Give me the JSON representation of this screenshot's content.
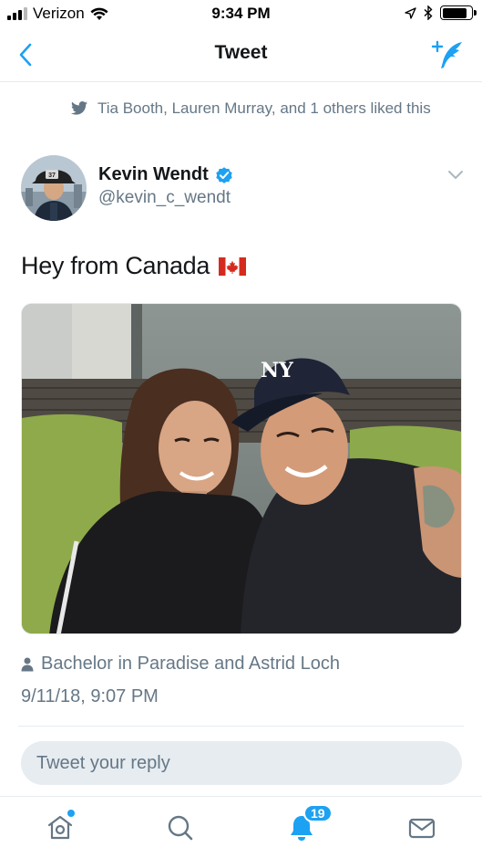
{
  "status_bar": {
    "carrier": "Verizon",
    "time": "9:34 PM",
    "battery_level": 0.85
  },
  "nav": {
    "title": "Tweet"
  },
  "social_context": {
    "text": "Tia Booth, Lauren Murray, and 1 others liked this"
  },
  "tweet": {
    "author_name": "Kevin Wendt",
    "author_handle": "@kevin_c_wendt",
    "text": "Hey from Canada",
    "place": "Bachelor in Paradise and Astrid Loch",
    "timestamp": "9/11/18, 9:07 PM"
  },
  "reply": {
    "placeholder": "Tweet your reply"
  },
  "tabbar": {
    "notifications_count": "19"
  },
  "colors": {
    "accent": "#1da1f2",
    "secondary_text": "#657786",
    "primary_text": "#14171a"
  },
  "icons": [
    "back-chevron-icon",
    "compose-icon",
    "twitter-bird-icon",
    "verified-icon",
    "chevron-down-icon",
    "canada-flag-icon",
    "person-icon",
    "home-icon",
    "search-icon",
    "notifications-icon",
    "messages-icon"
  ]
}
